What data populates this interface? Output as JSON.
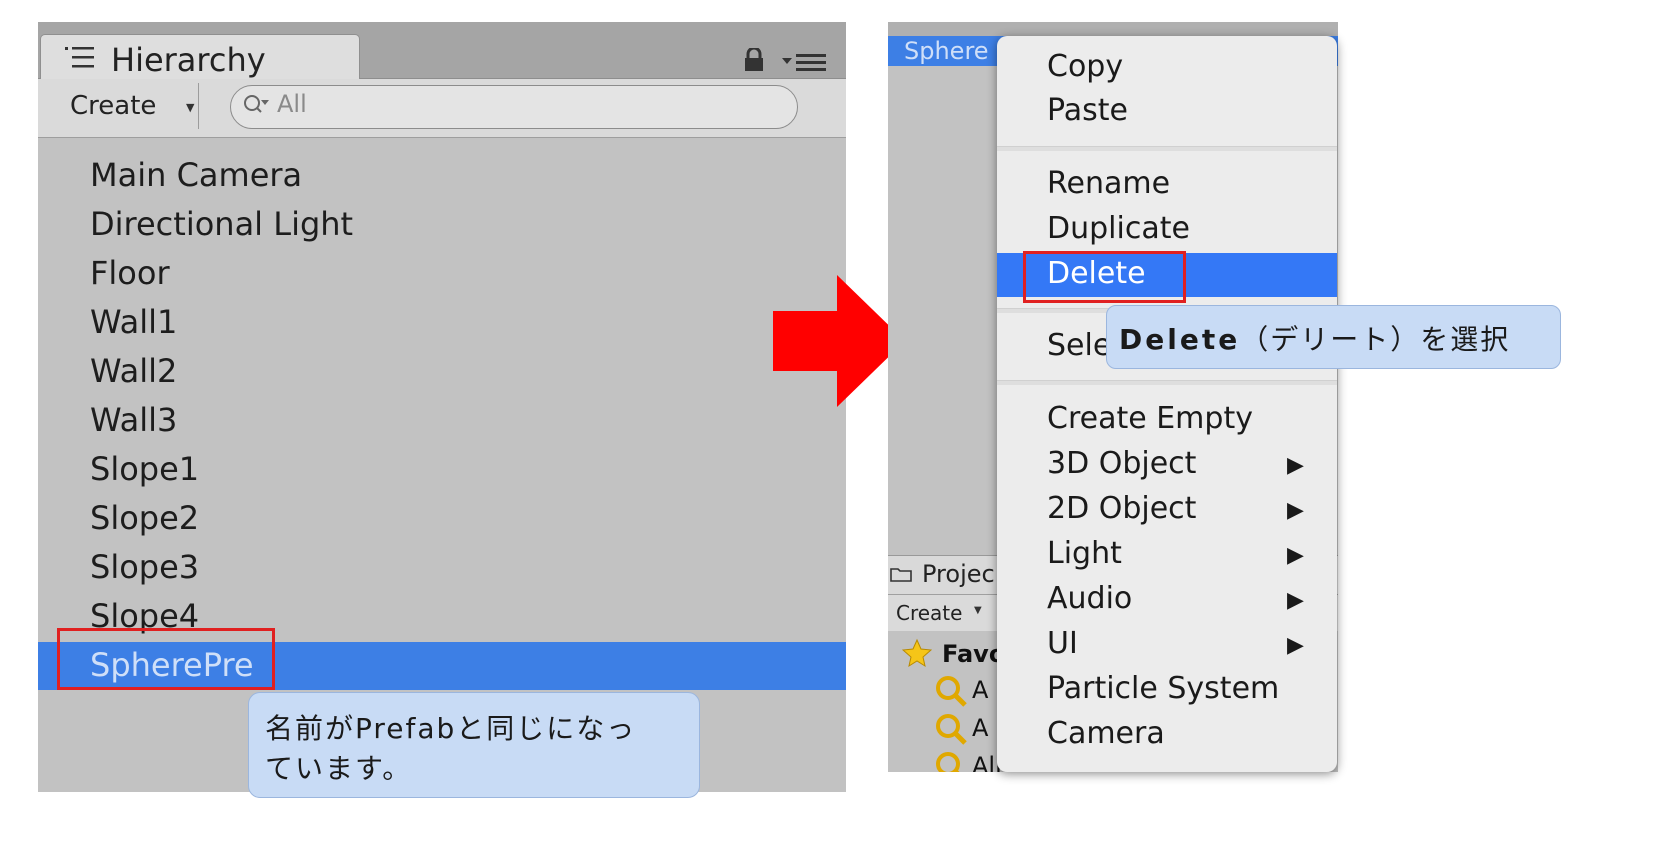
{
  "hierarchy": {
    "tab_title": "Hierarchy",
    "create_label": "Create",
    "search_placeholder": "All",
    "items": [
      "Main Camera",
      "Directional Light",
      "Floor",
      "Wall1",
      "Wall2",
      "Wall3",
      "Slope1",
      "Slope2",
      "Slope3",
      "Slope4",
      "SpherePre"
    ],
    "selected_index": 10
  },
  "notes": {
    "left_line1": "名前がPrefabと同じになっ",
    "left_line2": "ています。",
    "right_bold": "Delete",
    "right_rest": "（デリート）を選択"
  },
  "right_panel": {
    "selected_row_label": "Sphere",
    "project_label": "Projec",
    "project_create": "Create",
    "favorites_label": "Favo",
    "favorite_items": [
      "A",
      "A",
      "All Prefabs"
    ]
  },
  "context_menu": {
    "items": [
      {
        "label": "Copy",
        "submenu": false
      },
      {
        "label": "Paste",
        "submenu": false
      },
      {
        "label": "Rename",
        "submenu": false
      },
      {
        "label": "Duplicate",
        "submenu": false
      },
      {
        "label": "Delete",
        "submenu": false,
        "active": true
      },
      {
        "label": "Sele",
        "submenu": false
      },
      {
        "label": "Create Empty",
        "submenu": false
      },
      {
        "label": "3D Object",
        "submenu": true
      },
      {
        "label": "2D Object",
        "submenu": true
      },
      {
        "label": "Light",
        "submenu": true
      },
      {
        "label": "Audio",
        "submenu": true
      },
      {
        "label": "UI",
        "submenu": true
      },
      {
        "label": "Particle System",
        "submenu": false
      },
      {
        "label": "Camera",
        "submenu": false
      }
    ],
    "submenu_arrow": "▶"
  },
  "colors": {
    "selection_blue": "#3d7fe5",
    "menu_active_blue": "#3478f6",
    "highlight_red": "#e02020",
    "note_bg": "#c8dbf5",
    "arrow_red": "#ff0000"
  }
}
